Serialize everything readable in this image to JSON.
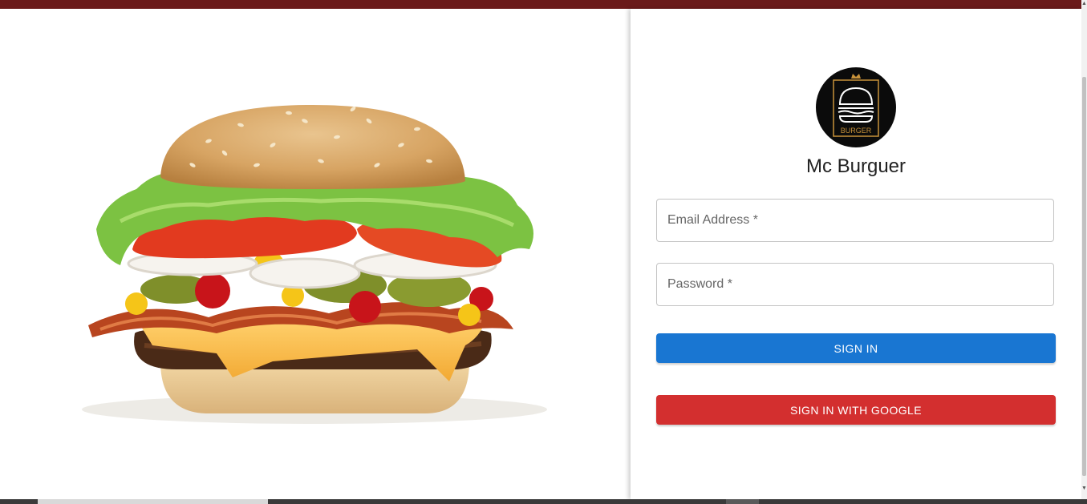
{
  "app": {
    "brand_name": "Mc Burguer",
    "logo_text": "BURGER"
  },
  "form": {
    "email": {
      "placeholder": "Email Address *",
      "value": ""
    },
    "password": {
      "placeholder": "Password *",
      "value": ""
    },
    "sign_in_label": "SIGN IN",
    "google_label": "SIGN IN WITH GOOGLE"
  },
  "colors": {
    "top_bar": "#6a1a1a",
    "primary_button": "#1976d2",
    "google_button": "#d32f2f",
    "logo_background": "#0b0b0b",
    "logo_accent": "#c8923a"
  },
  "icons": {
    "logo": "burger-crown-icon",
    "hero": "burger-image"
  }
}
